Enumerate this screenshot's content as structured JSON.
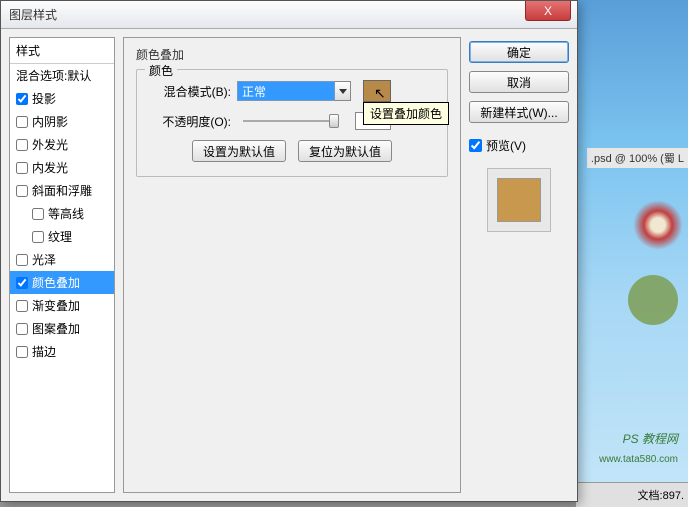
{
  "dialog": {
    "title": "图层样式",
    "close_x": "X"
  },
  "styles_panel": {
    "header": "样式",
    "blend_options": "混合选项:默认",
    "items": [
      {
        "label": "投影",
        "checked": true
      },
      {
        "label": "内阴影",
        "checked": false
      },
      {
        "label": "外发光",
        "checked": false
      },
      {
        "label": "内发光",
        "checked": false
      },
      {
        "label": "斜面和浮雕",
        "checked": false
      },
      {
        "label": "等高线",
        "checked": false,
        "indent": true
      },
      {
        "label": "纹理",
        "checked": false,
        "indent": true
      },
      {
        "label": "光泽",
        "checked": false
      },
      {
        "label": "颜色叠加",
        "checked": true,
        "selected": true
      },
      {
        "label": "渐变叠加",
        "checked": false
      },
      {
        "label": "图案叠加",
        "checked": false
      },
      {
        "label": "描边",
        "checked": false
      }
    ]
  },
  "center": {
    "section_title": "颜色叠加",
    "group_legend": "颜色",
    "blend_mode_label": "混合模式(B):",
    "blend_mode_value": "正常",
    "opacity_label": "不透明度(O):",
    "opacity_value": "100",
    "percent": "%",
    "color_swatch": "#b88a4a",
    "tooltip": "设置叠加颜色",
    "set_default": "设置为默认值",
    "reset_default": "复位为默认值"
  },
  "right": {
    "ok": "确定",
    "cancel": "取消",
    "new_style": "新建样式(W)...",
    "preview_label": "预览(V)",
    "preview_checked": true,
    "preview_color": "#c9984f"
  },
  "background": {
    "canvas_title": ".psd @ 100% (蜀 L",
    "brand": "PS 教程网",
    "url": "www.tata580.com",
    "status": "文档:897."
  }
}
